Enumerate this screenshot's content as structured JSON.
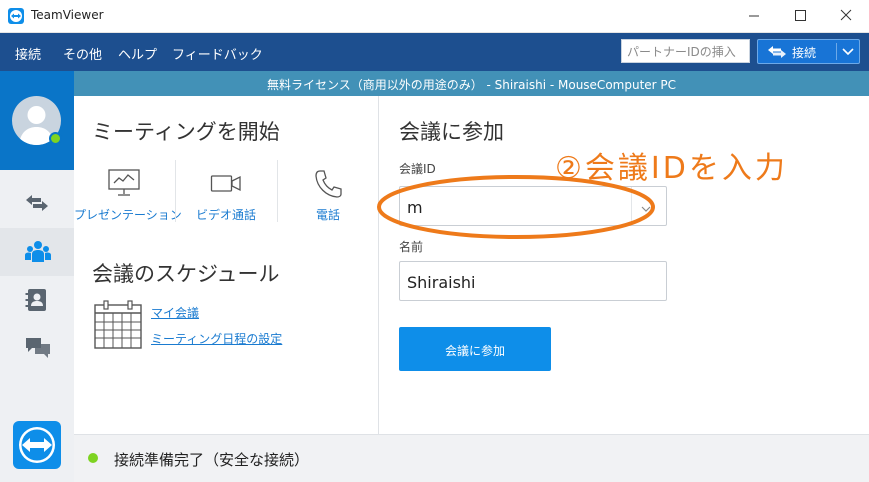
{
  "window": {
    "title": "TeamViewer"
  },
  "menu": {
    "items": [
      "接続",
      "その他",
      "ヘルプ",
      "フィードバック"
    ]
  },
  "toolbar": {
    "partner_id_placeholder": "パートナーIDの挿入",
    "connect_label": "接続"
  },
  "license_bar": {
    "text": "無料ライセンス（商用以外の用途のみ） - Shiraishi - MouseComputer PC"
  },
  "meeting": {
    "title": "ミーティングを開始",
    "options": [
      {
        "label": "プレゼンテーション",
        "icon": "presentation-icon"
      },
      {
        "label": "ビデオ通話",
        "icon": "video-camera-icon"
      },
      {
        "label": "電話",
        "icon": "phone-icon"
      }
    ],
    "schedule_title": "会議のスケジュール",
    "schedule_links": [
      "マイ会議",
      "ミーティング日程の設定"
    ]
  },
  "join": {
    "title": "会議に参加",
    "id_label": "会議ID",
    "id_value": "m",
    "name_label": "名前",
    "name_value": "Shiraishi",
    "button_label": "会議に参加"
  },
  "annotation": {
    "text": "②会議IDを入力",
    "color": "#ee7a1a"
  },
  "status": {
    "text": "接続準備完了（安全な接続）",
    "color": "#7ed321"
  },
  "colors": {
    "toolbar": "#1d4f8f",
    "license_bar": "#4291b7",
    "accent": "#0e8ee9",
    "sidebar_head": "#0a75c8"
  }
}
